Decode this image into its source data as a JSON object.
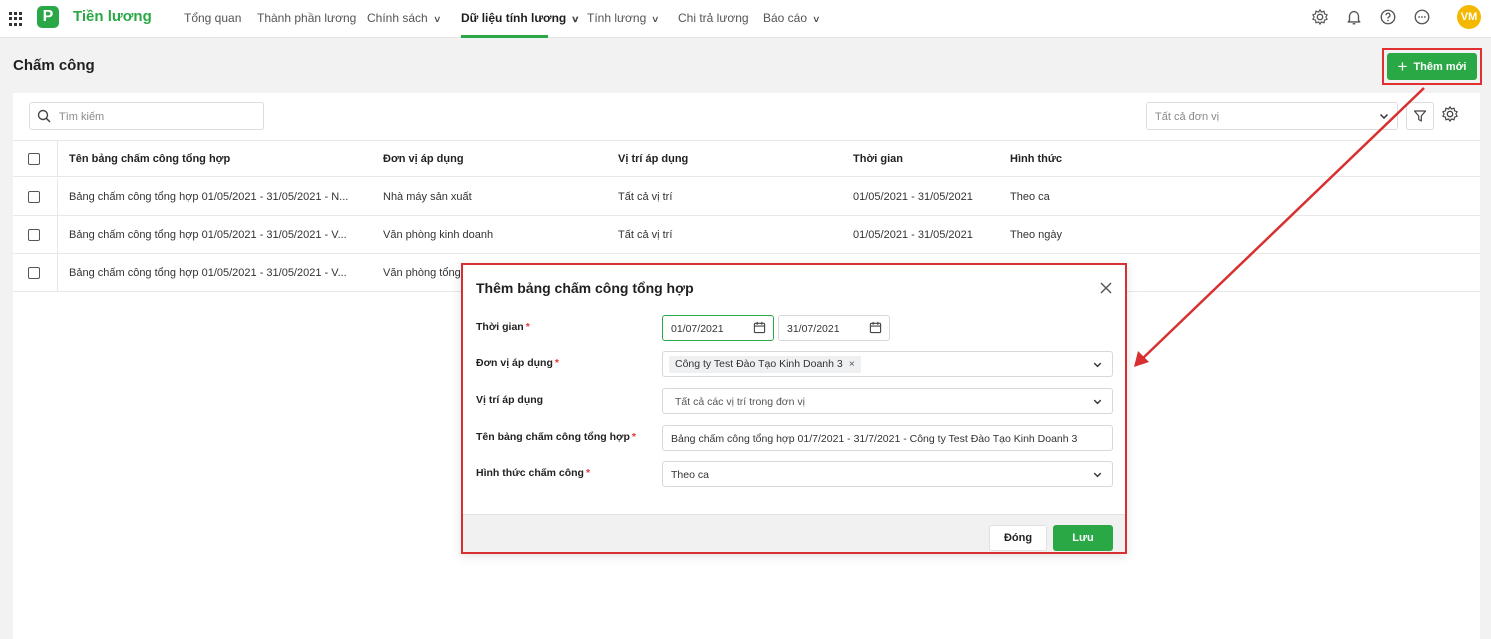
{
  "app": {
    "name": "Tiền lương",
    "logo_letter": "P",
    "user_initials": "VM"
  },
  "nav": [
    {
      "label": "Tổng quan",
      "has_caret": false
    },
    {
      "label": "Thành phần lương",
      "has_caret": false
    },
    {
      "label": "Chính sách",
      "has_caret": true
    },
    {
      "label": "Dữ liệu tính lương",
      "has_caret": true,
      "active": true
    },
    {
      "label": "Tính lương",
      "has_caret": true
    },
    {
      "label": "Chi trả lương",
      "has_caret": false
    },
    {
      "label": "Báo cáo",
      "has_caret": true
    }
  ],
  "top_icons": [
    "settings-icon",
    "bell-icon",
    "help-icon",
    "more-icon"
  ],
  "page": {
    "title": "Chấm công",
    "add_label": "Thêm mới"
  },
  "toolbar": {
    "search_placeholder": "Tìm kiếm",
    "unit_placeholder": "Tất cả đơn vị"
  },
  "table": {
    "headers": [
      "Tên bảng chấm công tổng hợp",
      "Đơn vị áp dụng",
      "Vị trí áp dụng",
      "Thời gian",
      "Hình thức"
    ],
    "rows": [
      [
        "Bảng chấm công tổng hợp 01/05/2021 - 31/05/2021 - N...",
        "Nhà máy sản xuất",
        "Tất cả vị trí",
        "01/05/2021 - 31/05/2021",
        "Theo ca"
      ],
      [
        "Bảng chấm công tổng hợp 01/05/2021 - 31/05/2021 - V...",
        "Văn phòng kinh doanh",
        "Tất cả vị trí",
        "01/05/2021 - 31/05/2021",
        "Theo ngày"
      ],
      [
        "Bảng chấm công tổng hợp 01/05/2021 - 31/05/2021 - V...",
        "Văn phòng tổng",
        "",
        "",
        ""
      ]
    ]
  },
  "dialog": {
    "title": "Thêm bảng chấm công tổng hợp",
    "time_label": "Thời gian",
    "date_from": "01/07/2021",
    "date_to": "31/07/2021",
    "unit_label": "Đơn vị áp dụng",
    "unit_chip": "Công ty Test Đào Tạo Kinh Doanh 3",
    "position_label": "Vị trí áp dụng",
    "position_value": "Tất cả các vị trí trong đơn vị",
    "name_label": "Tên bảng chấm công tổng hợp",
    "name_value": "Bảng chấm công tổng hợp 01/7/2021 - 31/7/2021 - Công ty Test Đào Tạo Kinh Doanh 3",
    "type_label": "Hình thức chấm công",
    "type_value": "Theo ca",
    "close_label": "Đóng",
    "save_label": "Lưu"
  },
  "colors": {
    "accent": "#2aa845",
    "highlight": "#d83030",
    "avatar": "#f5b800"
  }
}
